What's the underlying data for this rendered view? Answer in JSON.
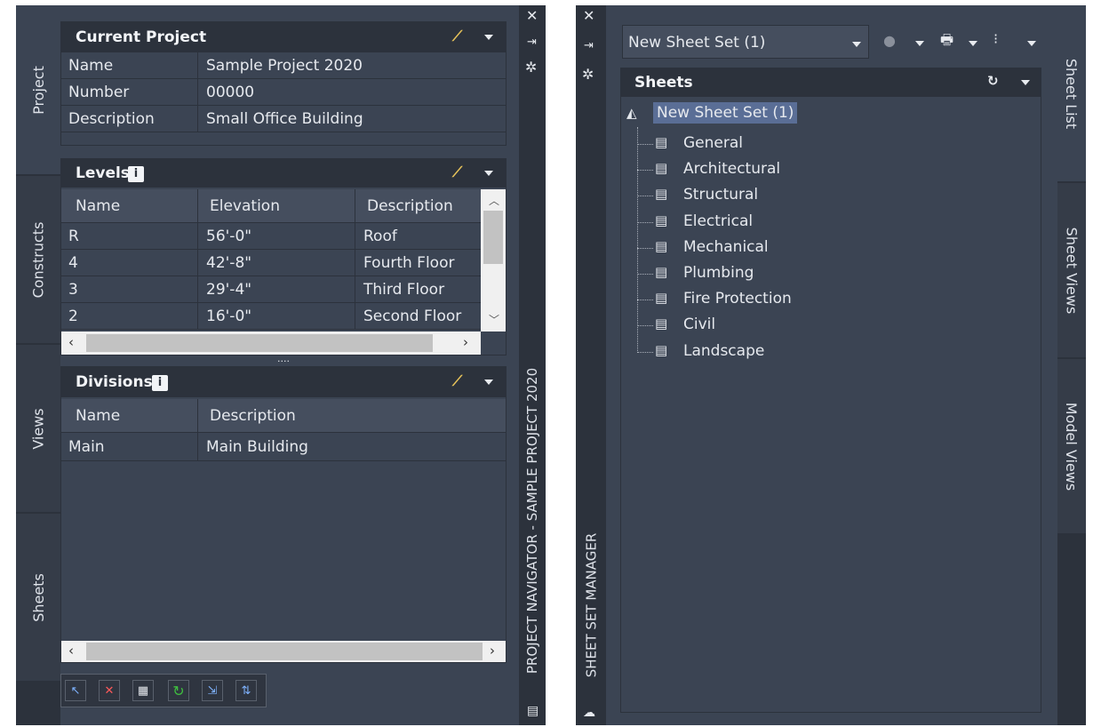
{
  "project_navigator": {
    "side_tabs": [
      {
        "label": "Project"
      },
      {
        "label": "Constructs"
      },
      {
        "label": "Views"
      },
      {
        "label": "Sheets"
      }
    ],
    "right_title": "PROJECT NAVIGATOR - SAMPLE PROJECT 2020",
    "current_project": {
      "title": "Current Project",
      "rows": [
        {
          "label": "Name",
          "value": "Sample Project 2020"
        },
        {
          "label": "Number",
          "value": "00000"
        },
        {
          "label": "Description",
          "value": "Small Office Building"
        }
      ]
    },
    "levels": {
      "title": "Levels",
      "columns": [
        "Name",
        "Elevation",
        "Description"
      ],
      "rows": [
        {
          "name": "R",
          "elevation": "56'-0\"",
          "description": "Roof"
        },
        {
          "name": "4",
          "elevation": "42'-8\"",
          "description": "Fourth Floor"
        },
        {
          "name": "3",
          "elevation": "29'-4\"",
          "description": "Third Floor"
        },
        {
          "name": "2",
          "elevation": "16'-0\"",
          "description": "Second Floor"
        }
      ]
    },
    "splitter": "....",
    "divisions": {
      "title": "Divisions",
      "columns": [
        "Name",
        "Description"
      ],
      "rows": [
        {
          "name": "Main",
          "description": "Main Building"
        }
      ]
    },
    "toolbar_icons": [
      "select-icon",
      "delete-icon",
      "table-icon",
      "refresh-icon",
      "repath-icon",
      "sync-icon"
    ]
  },
  "sheet_set_manager": {
    "left_title": "SHEET SET MANAGER",
    "dropdown_value": "New Sheet Set (1)",
    "sheets_title": "Sheets",
    "root": "New Sheet Set (1)",
    "subsets": [
      "General",
      "Architectural",
      "Structural",
      "Electrical",
      "Mechanical",
      "Plumbing",
      "Fire Protection",
      "Civil",
      "Landscape"
    ],
    "right_tabs": [
      {
        "label": "Sheet List"
      },
      {
        "label": "Sheet Views"
      },
      {
        "label": "Model Views"
      }
    ]
  },
  "colors": {
    "panel": "#3b4453",
    "header": "#2c323c",
    "selection": "#5a6e96",
    "accent_green": "#3fbf3f"
  }
}
